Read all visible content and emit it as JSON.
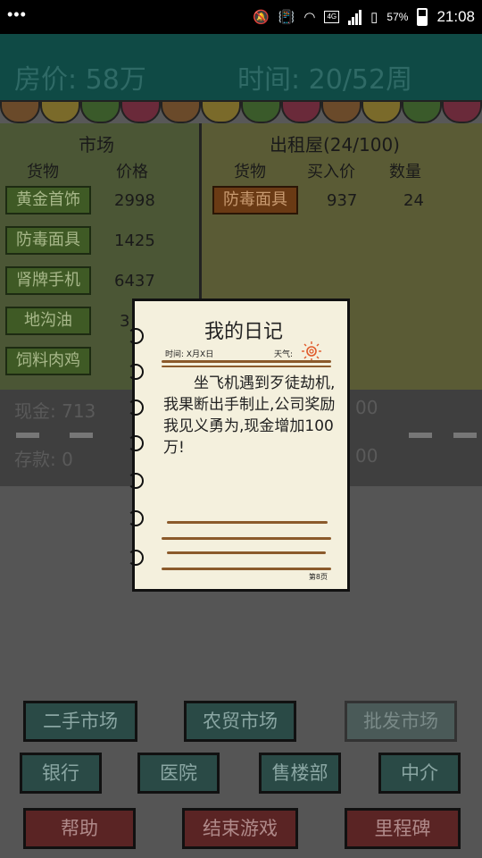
{
  "status": {
    "time": "21:08",
    "battery": "57%",
    "network": "4G"
  },
  "header": {
    "price": "房价: 58万",
    "time": "时间: 20/52周"
  },
  "awning_colors": [
    "#6a4a2a",
    "#7a6a2a",
    "#3a5a2a",
    "#6a2a3a",
    "#6a4a2a",
    "#7a6a2a",
    "#3a5a2a",
    "#6a2a3a",
    "#6a4a2a",
    "#7a6a2a",
    "#3a5a2a",
    "#6a2a3a"
  ],
  "market": {
    "title": "市场",
    "col_goods": "货物",
    "col_price": "价格",
    "items": [
      {
        "name": "黄金首饰",
        "price": "2998"
      },
      {
        "name": "防毒面具",
        "price": "1425"
      },
      {
        "name": "肾牌手机",
        "price": "6437"
      },
      {
        "name": "地沟油",
        "price": "3"
      },
      {
        "name": "饲料肉鸡",
        "price": ""
      }
    ]
  },
  "rental": {
    "title": "出租屋(24/100)",
    "col_goods": "货物",
    "col_buy": "买入价",
    "col_qty": "数量",
    "items": [
      {
        "name": "防毒面具",
        "buy": "937",
        "qty": "24"
      }
    ]
  },
  "finance": {
    "cash": "现金: 713",
    "deposit": "存款: 0",
    "right_top": "00",
    "right_bottom": "00"
  },
  "buttons": {
    "second_hand": "二手市场",
    "farm_market": "农贸市场",
    "wholesale": "批发市场",
    "bank": "银行",
    "hospital": "医院",
    "sales_office": "售楼部",
    "agent": "中介",
    "help": "帮助",
    "end_game": "结束游戏",
    "milestone": "里程碑"
  },
  "diary": {
    "title": "我的日记",
    "date": "时间: X月X日",
    "weather": "天气:",
    "body": "坐飞机遇到歹徒劫机,我果断出手制止,公司奖励我见义勇为,现金增加100万!",
    "page": "第8页"
  }
}
